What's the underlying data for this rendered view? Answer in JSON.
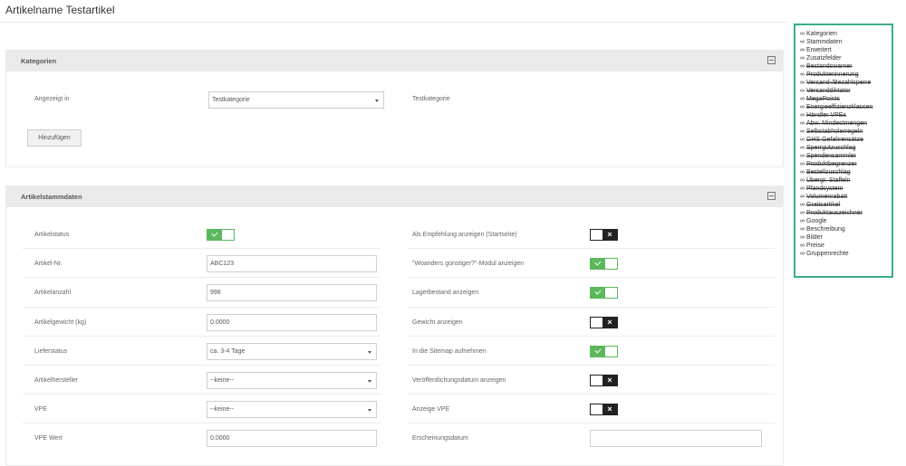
{
  "page": {
    "title": "Artikelname Testartikel"
  },
  "kategorien": {
    "title": "Kategorien",
    "shown_in_label": "Angezeigt in",
    "select_value": "Testkategorie",
    "selected_category": "Testkategorie",
    "add_button": "Hinzufügen"
  },
  "stammdaten": {
    "title": "Artikelstammdaten",
    "left": [
      {
        "label": "Artikelstatus",
        "kind": "toggle",
        "on": true
      },
      {
        "label": "Artikel-Nr.",
        "kind": "input",
        "value": "ABC123"
      },
      {
        "label": "Artikelanzahl",
        "kind": "input",
        "value": "998"
      },
      {
        "label": "Artikelgewicht (kg)",
        "kind": "input",
        "value": "0.0000"
      },
      {
        "label": "Lieferstatus",
        "kind": "select",
        "value": "ca. 3-4 Tage"
      },
      {
        "label": "Artikelhersteller",
        "kind": "select",
        "value": "--keine--"
      },
      {
        "label": "VPE",
        "kind": "select",
        "value": "--keine--"
      },
      {
        "label": "VPE Wert",
        "kind": "input",
        "value": "0.0000"
      }
    ],
    "right": [
      {
        "label": "Als Empfehlung anzeigen (Startseite)",
        "kind": "toggle",
        "on": false
      },
      {
        "label": "\"Woanders günstiger?\"-Modul anzeigen",
        "kind": "toggle",
        "on": true
      },
      {
        "label": "Lagerbestand anzeigen",
        "kind": "toggle",
        "on": true
      },
      {
        "label": "Gewicht anzeigen",
        "kind": "toggle",
        "on": false
      },
      {
        "label": "In die Sitemap aufnehmen",
        "kind": "toggle",
        "on": true
      },
      {
        "label": "Veröffentlichungsdatum anzeigen",
        "kind": "toggle",
        "on": false
      },
      {
        "label": "Anzeige VPE",
        "kind": "toggle",
        "on": false
      },
      {
        "label": "Erscheinungsdatum",
        "kind": "input",
        "value": ""
      }
    ]
  },
  "nav": {
    "icon": "link-icon",
    "items": [
      {
        "label": "Kategorien",
        "disabled": false
      },
      {
        "label": "Stammdaten",
        "disabled": false
      },
      {
        "label": "Erweitert",
        "disabled": false
      },
      {
        "label": "Zusatzfelder",
        "disabled": false
      },
      {
        "label": "Bestandswarner",
        "disabled": true
      },
      {
        "label": "Produkterinnerung",
        "disabled": true
      },
      {
        "label": "Versand-/Bezahlsperre",
        "disabled": true
      },
      {
        "label": "Versanddiktator",
        "disabled": true
      },
      {
        "label": "MegaPoints",
        "disabled": true
      },
      {
        "label": "Energieeffizienzklassen",
        "disabled": true
      },
      {
        "label": "Händler VPEs",
        "disabled": true
      },
      {
        "label": "Abw. Mindestmengen",
        "disabled": true
      },
      {
        "label": "Selbstabholerregeln",
        "disabled": true
      },
      {
        "label": "GHS Gefahrensätze",
        "disabled": true
      },
      {
        "label": "Sperrgutzuschlag",
        "disabled": true
      },
      {
        "label": "Spendensammler",
        "disabled": true
      },
      {
        "label": "Produktbegrenzer",
        "disabled": true
      },
      {
        "label": "Bestellzuschlag",
        "disabled": true
      },
      {
        "label": "Übergr. Staffeln",
        "disabled": true
      },
      {
        "label": "Pfandsystem",
        "disabled": true
      },
      {
        "label": "Volumenrabatt",
        "disabled": true
      },
      {
        "label": "Gratisartikel",
        "disabled": true
      },
      {
        "label": "Produktauszeichner",
        "disabled": true
      },
      {
        "label": "Google",
        "disabled": false
      },
      {
        "label": "Beschreibung",
        "disabled": false
      },
      {
        "label": "Bilder",
        "disabled": false
      },
      {
        "label": "Preise",
        "disabled": false
      },
      {
        "label": "Gruppenrechte",
        "disabled": false
      }
    ]
  },
  "colors": {
    "toggle_on": "#5cb85c",
    "toggle_off": "#222222",
    "nav_border": "#3cae8c"
  }
}
